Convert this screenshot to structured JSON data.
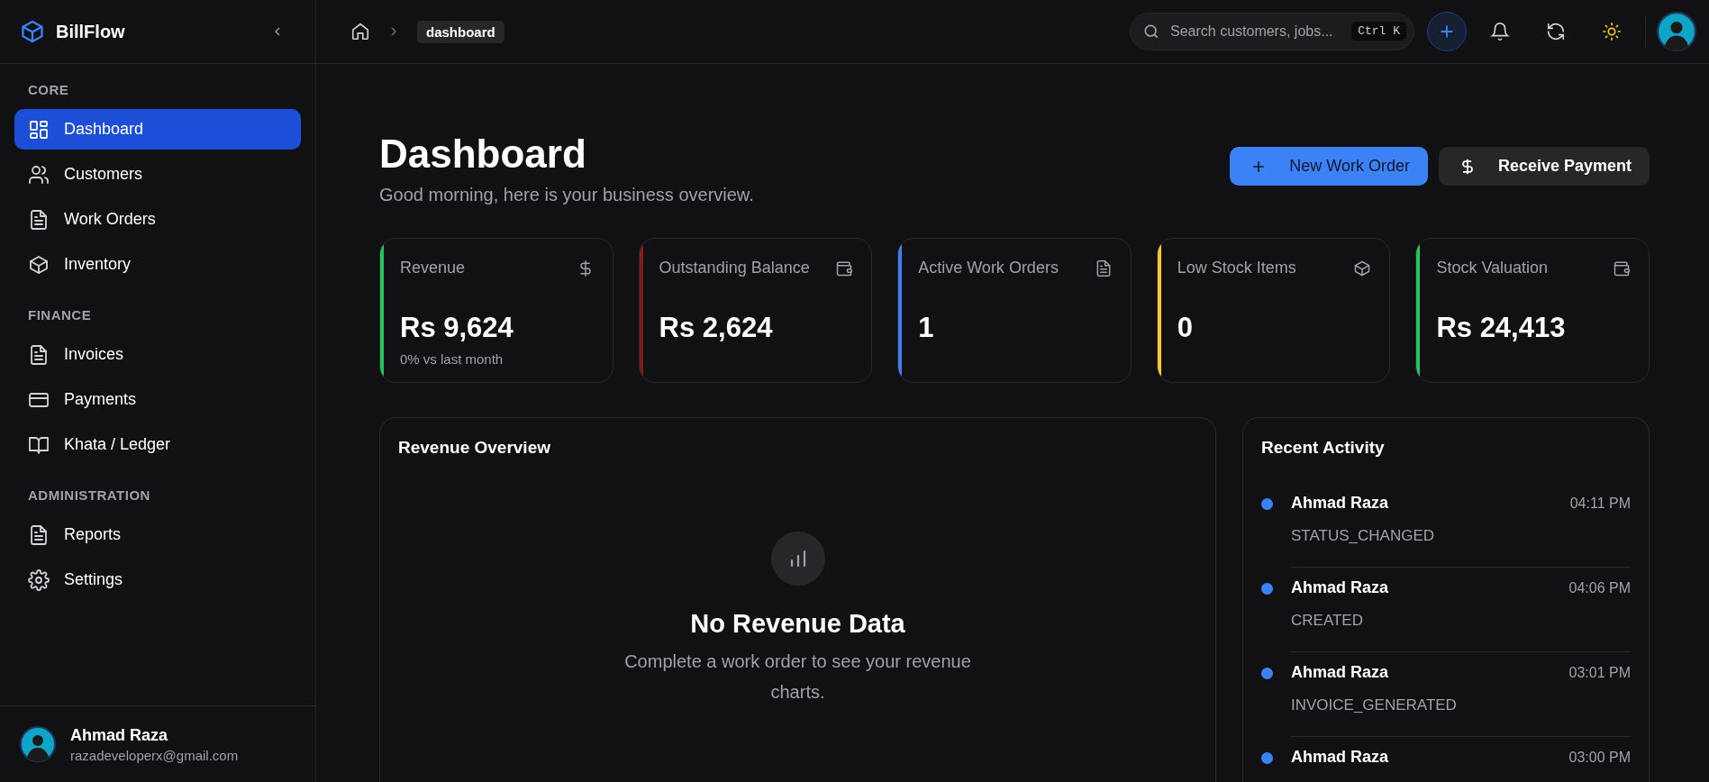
{
  "app": {
    "name": "BillFlow"
  },
  "sidebar": {
    "sections": [
      {
        "title": "CORE",
        "items": [
          {
            "label": "Dashboard",
            "selected": true
          },
          {
            "label": "Customers",
            "selected": false
          },
          {
            "label": "Work Orders",
            "selected": false
          },
          {
            "label": "Inventory",
            "selected": false
          }
        ]
      },
      {
        "title": "FINANCE",
        "items": [
          {
            "label": "Invoices",
            "selected": false
          },
          {
            "label": "Payments",
            "selected": false
          },
          {
            "label": "Khata / Ledger",
            "selected": false
          }
        ]
      },
      {
        "title": "ADMINISTRATION",
        "items": [
          {
            "label": "Reports",
            "selected": false
          },
          {
            "label": "Settings",
            "selected": false
          }
        ]
      }
    ],
    "user": {
      "name": "Ahmad Raza",
      "email": "razadeveloperx@gmail.com"
    }
  },
  "breadcrumb": {
    "current": "dashboard"
  },
  "search": {
    "placeholder": "Search customers, jobs...",
    "shortcut": "Ctrl K"
  },
  "page": {
    "title": "Dashboard",
    "subtitle": "Good morning, here is your business overview."
  },
  "actions": [
    {
      "label": "New Work Order",
      "kind": "primary"
    },
    {
      "label": "Receive Payment",
      "kind": "secondary"
    }
  ],
  "stats": [
    {
      "label": "Revenue",
      "value": "Rs 9,624",
      "note": "0% vs last month",
      "color": "#22c55e"
    },
    {
      "label": "Outstanding Balance",
      "value": "Rs 2,624",
      "color": "#7f1d1d"
    },
    {
      "label": "Active Work Orders",
      "value": "1",
      "color": "#3b82f6"
    },
    {
      "label": "Low Stock Items",
      "value": "0",
      "color": "#facc15"
    },
    {
      "label": "Stock Valuation",
      "value": "Rs 24,413",
      "color": "#22c55e"
    }
  ],
  "revenue_overview": {
    "title": "Revenue Overview",
    "empty_title": "No Revenue Data",
    "empty_text": "Complete a work order to see your revenue charts."
  },
  "recent_activity": {
    "title": "Recent Activity",
    "items": [
      {
        "name": "Ahmad Raza",
        "action": "STATUS_CHANGED",
        "time": "04:11 PM"
      },
      {
        "name": "Ahmad Raza",
        "action": "CREATED",
        "time": "04:06 PM"
      },
      {
        "name": "Ahmad Raza",
        "action": "INVOICE_GENERATED",
        "time": "03:01 PM"
      },
      {
        "name": "Ahmad Raza",
        "time": "03:00 PM"
      }
    ]
  }
}
